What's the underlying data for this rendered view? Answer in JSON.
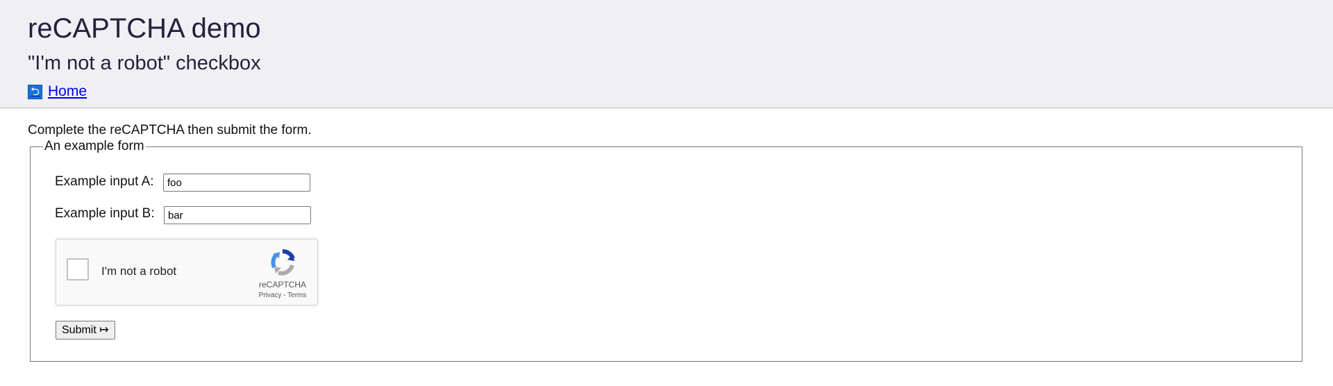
{
  "header": {
    "title": "reCAPTCHA demo",
    "subtitle": "\"I'm not a robot\" checkbox",
    "home_icon": "return-arrow-icon",
    "home_icon_glyph": "⮌",
    "home_link": "Home"
  },
  "main": {
    "intro": "Complete the reCAPTCHA then submit the form.",
    "form": {
      "legend": "An example form",
      "input_a": {
        "label": "Example input A:",
        "value": "foo"
      },
      "input_b": {
        "label": "Example input B:",
        "value": "bar"
      },
      "recaptcha": {
        "checkbox_label": "I'm not a robot",
        "brand": "reCAPTCHA",
        "privacy": "Privacy",
        "separator": " - ",
        "terms": "Terms",
        "logo_icon": "recaptcha-logo-icon"
      },
      "submit_label": "Submit ↦"
    }
  },
  "colors": {
    "header_bg": "#f0eff4",
    "title_text": "#22223b",
    "link": "#0000ee"
  }
}
